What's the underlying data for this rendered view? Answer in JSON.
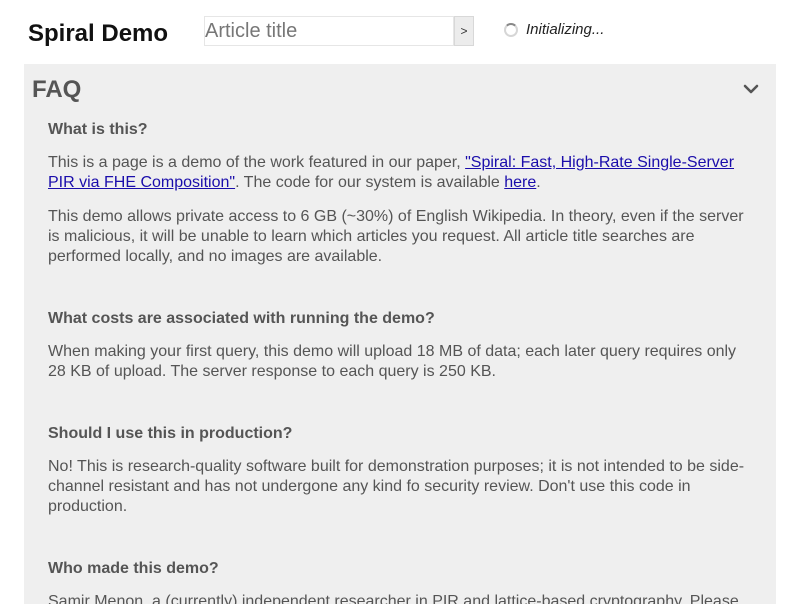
{
  "brand": "Spiral Demo",
  "search": {
    "placeholder": "Article title",
    "button_label": ">"
  },
  "status": {
    "text": "Initializing..."
  },
  "faq": {
    "title": "FAQ",
    "items": [
      {
        "question": "What is this?",
        "p1_pre": "This is a page is a demo of the work featured in our paper, ",
        "p1_link": "\"Spiral: Fast, High-Rate Single-Server PIR via FHE Composition\"",
        "p1_mid": ". The code for our system is available ",
        "p1_link2": "here",
        "p1_post": ".",
        "p2": "This demo allows private access to 6 GB (~30%) of English Wikipedia. In theory, even if the server is malicious, it will be unable to learn which articles you request. All article title searches are performed locally, and no images are available."
      },
      {
        "question": "What costs are associated with running the demo?",
        "p1": "When making your first query, this demo will upload 18 MB of data; each later query requires only 28 KB of upload. The server response to each query is 250 KB."
      },
      {
        "question": "Should I use this in production?",
        "p1": "No! This is research-quality software built for demonstration purposes; it is not intended to be side-channel resistant and has not undergone any kind fo security review. Don't use this code in production."
      },
      {
        "question": "Who made this demo?",
        "p1": "Samir Menon, a (currently) independent researcher in PIR and lattice-based cryptography. Please"
      }
    ]
  }
}
